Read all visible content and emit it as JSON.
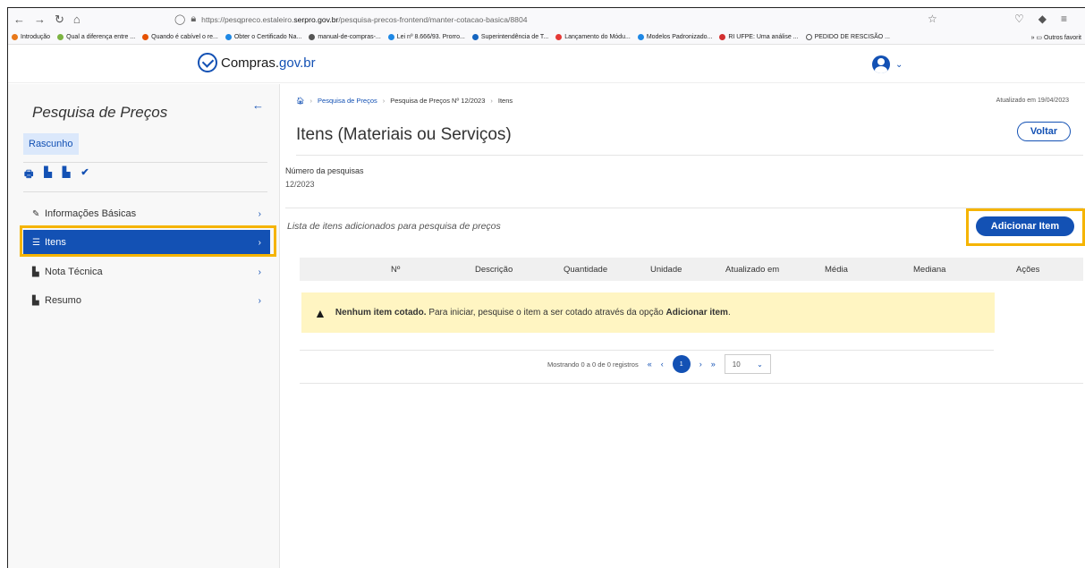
{
  "browser": {
    "url_prefix": "https://pesqpreco.estaleiro.",
    "url_domain": "serpro.gov.br",
    "url_path": "/pesquisa-precos-frontend/manter-cotacao-basica/8804",
    "bookmarks": [
      "Introdução",
      "Qual a diferença entre ...",
      "Quando é cabível o re...",
      "Obter o Certificado Na...",
      "manual-de-compras-...",
      "Lei nº 8.666/93. Prorro...",
      "Superintendência de T...",
      "Lançamento do Módu...",
      "Modelos Padronizado...",
      "RI UFPE: Uma análise ...",
      "PEDIDO DE RESCISÃO ..."
    ],
    "other_favorites": "Outros favorit"
  },
  "header": {
    "logo_main": "Compras.",
    "logo_gov": "gov.br"
  },
  "sidebar": {
    "title": "Pesquisa de Preços",
    "status_badge": "Rascunho",
    "items": [
      {
        "label": "Informações Básicas",
        "icon": "pencil-icon"
      },
      {
        "label": "Itens",
        "icon": "list-icon"
      },
      {
        "label": "Nota Técnica",
        "icon": "document-icon"
      },
      {
        "label": "Resumo",
        "icon": "document-icon"
      }
    ]
  },
  "main": {
    "breadcrumb": [
      "Pesquisa de Preços",
      "Pesquisa de Preços Nº 12/2023",
      "Itens"
    ],
    "updated": "Atualizado em 19/04/2023",
    "title": "Itens (Materiais ou Serviços)",
    "back_button": "Voltar",
    "number_label": "Número da pesquisas",
    "number_value": "12/2023",
    "list_label": "Lista de itens adicionados para pesquisa de preços",
    "add_button": "Adicionar Item",
    "table_headers": [
      "Nº",
      "Descrição",
      "Quantidade",
      "Unidade",
      "Atualizado em",
      "Média",
      "Mediana",
      "Ações"
    ],
    "alert_bold": "Nenhum item cotado.",
    "alert_text": " Para iniciar, pesquise o item a ser cotado através da opção ",
    "alert_bold2": "Adicionar item",
    "alert_end": ".",
    "pager_info": "Mostrando 0 a 0 de 0 registros",
    "pager_current": "1",
    "page_size": "10"
  },
  "colors": {
    "primary": "#1351b4",
    "highlight": "#f5b400",
    "alert_bg": "#fff5c2"
  }
}
